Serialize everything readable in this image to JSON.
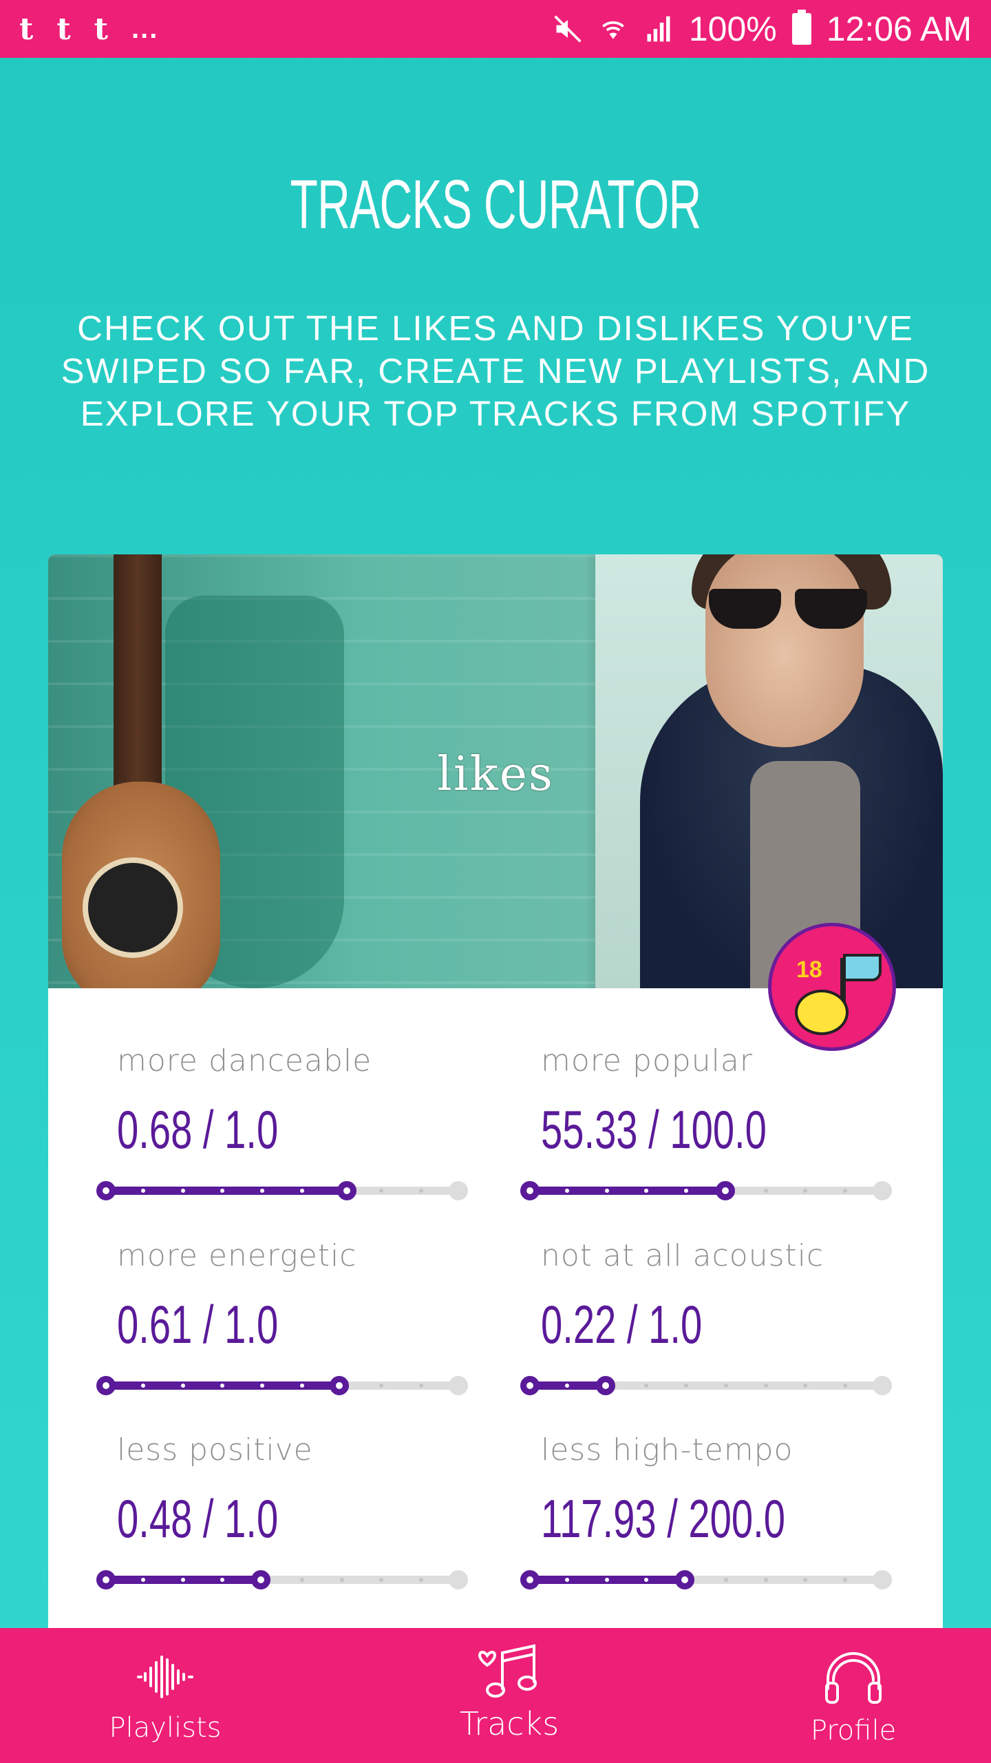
{
  "status_bar": {
    "notifications": [
      "t",
      "t",
      "t"
    ],
    "overflow": "...",
    "battery": "100%",
    "time": "12:06 AM"
  },
  "header": {
    "title": "TRACKS CURATOR",
    "subtitle": "CHECK OUT THE LIKES AND DISLIKES YOU'VE SWIPED SO FAR, CREATE NEW PLAYLISTS, AND EXPLORE YOUR TOP TRACKS FROM SPOTIFY"
  },
  "card": {
    "hero_label": "likes",
    "badge_age": "18",
    "stats": [
      {
        "label": "more danceable",
        "value": "0.68 / 1.0",
        "fraction": 0.68
      },
      {
        "label": "more popular",
        "value": "55.33 / 100.0",
        "fraction": 0.5533
      },
      {
        "label": "more energetic",
        "value": "0.61 / 1.0",
        "fraction": 0.66
      },
      {
        "label": "not at all acoustic",
        "value": "0.22 / 1.0",
        "fraction": 0.22
      },
      {
        "label": "less positive",
        "value": "0.48 / 1.0",
        "fraction": 0.44
      },
      {
        "label": "less high-tempo",
        "value": "117.93 / 200.0",
        "fraction": 0.44
      }
    ]
  },
  "bottom_nav": {
    "items": [
      {
        "label": "Playlists",
        "icon": "waveform-icon",
        "active": false
      },
      {
        "label": "Tracks",
        "icon": "music-note-heart-icon",
        "active": true
      },
      {
        "label": "Profile",
        "icon": "headphones-icon",
        "active": false
      }
    ]
  },
  "colors": {
    "accent_pink": "#ee1f77",
    "teal": "#2ccfc6",
    "purple": "#5a1a99"
  }
}
